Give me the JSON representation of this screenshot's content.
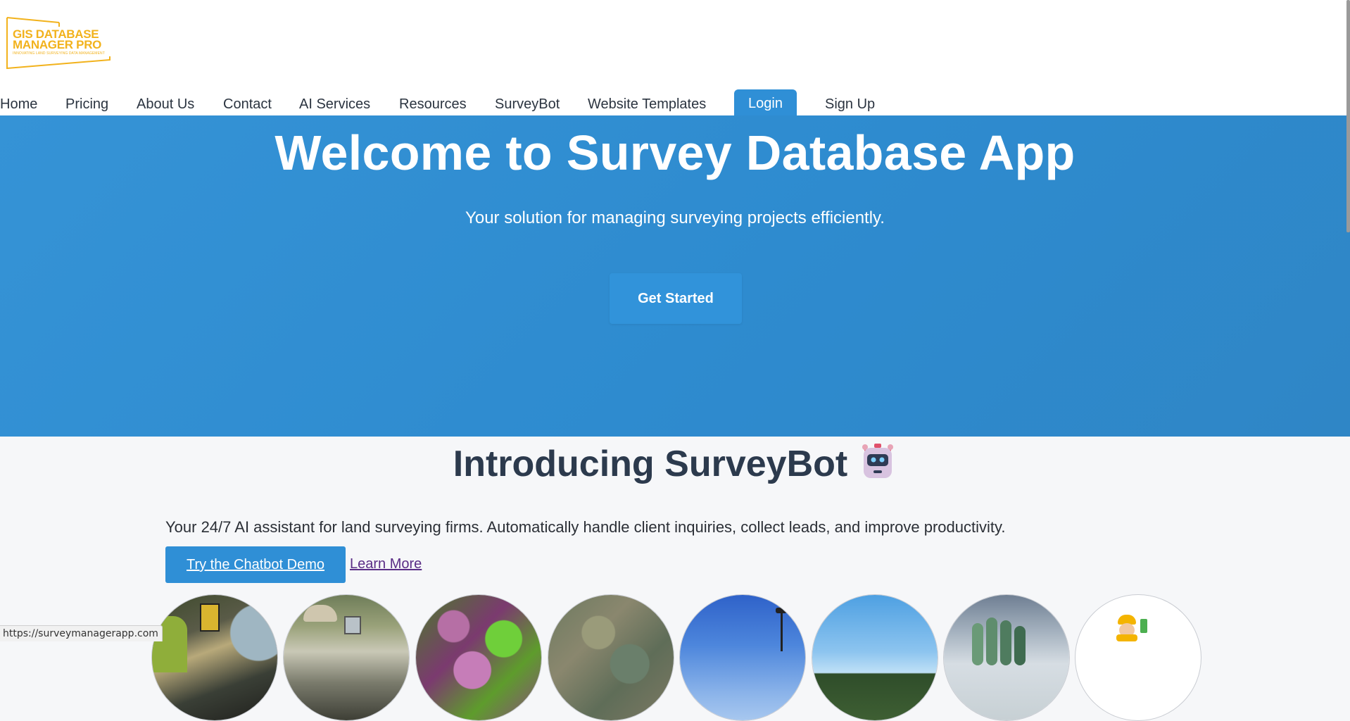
{
  "header": {
    "logo": {
      "line1": "GIS DATABASE",
      "line2": "MANAGER PRO",
      "tagline": "INNOVATING LAND SURVEYING DATA MANAGEMENT"
    },
    "nav": {
      "home": "Home",
      "pricing": "Pricing",
      "about": "About Us",
      "contact": "Contact",
      "ai_services": "AI Services",
      "resources": "Resources",
      "surveybot": "SurveyBot",
      "templates": "Website Templates",
      "login": "Login",
      "signup": "Sign Up"
    }
  },
  "hero": {
    "title": "Welcome to Survey Database App",
    "subtitle": "Your solution for managing surveying projects efficiently.",
    "cta": "Get Started"
  },
  "surveybot": {
    "title": "Introducing SurveyBot",
    "icon": "robot-icon",
    "description": "Your 24/7 AI assistant for land surveying firms. Automatically handle client inquiries, collect leads, and improve productivity.",
    "demo_button": "Try the Chatbot Demo",
    "learn_more": "Learn More"
  },
  "gallery": {
    "items": [
      "surveyor-total-station",
      "surveyor-field-equipment",
      "satellite-terrain-map",
      "aerial-land-map",
      "drone-site-sky",
      "field-trees-sky",
      "hand-sky-landscape",
      "surveyor-cartoon"
    ]
  },
  "status_bar": {
    "url": "https://surveymanagerapp.com"
  },
  "colors": {
    "primary": "#2f8fd6",
    "hero_bg": "#3190d3",
    "logo": "#f2b21c",
    "heading": "#2c3a4d"
  }
}
